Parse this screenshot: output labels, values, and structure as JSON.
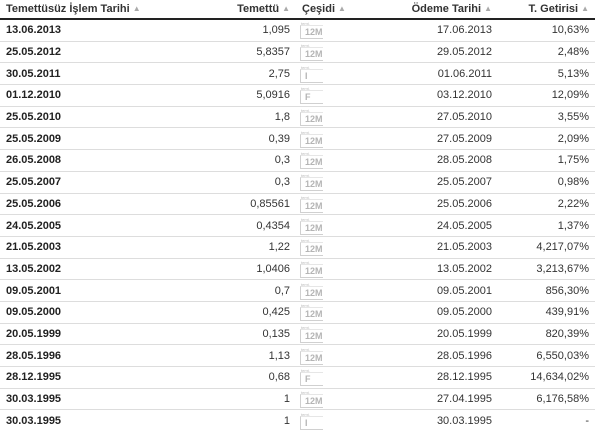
{
  "table": {
    "headers": {
      "date": "Temettüsüz İşlem Tarihi",
      "amount": "Temettü",
      "type": "Çeşidi",
      "payment_date": "Ödeme Tarihi",
      "yield": "T. Getirisi"
    },
    "type_icon_small_text": "temt.",
    "rows": [
      {
        "date": "13.06.2013",
        "amount": "1,095",
        "type": "12M",
        "payment_date": "17.06.2013",
        "yield": "10,63%"
      },
      {
        "date": "25.05.2012",
        "amount": "5,8357",
        "type": "12M",
        "payment_date": "29.05.2012",
        "yield": "2,48%"
      },
      {
        "date": "30.05.2011",
        "amount": "2,75",
        "type": "I",
        "payment_date": "01.06.2011",
        "yield": "5,13%"
      },
      {
        "date": "01.12.2010",
        "amount": "5,0916",
        "type": "F",
        "payment_date": "03.12.2010",
        "yield": "12,09%"
      },
      {
        "date": "25.05.2010",
        "amount": "1,8",
        "type": "12M",
        "payment_date": "27.05.2010",
        "yield": "3,55%"
      },
      {
        "date": "25.05.2009",
        "amount": "0,39",
        "type": "12M",
        "payment_date": "27.05.2009",
        "yield": "2,09%"
      },
      {
        "date": "26.05.2008",
        "amount": "0,3",
        "type": "12M",
        "payment_date": "28.05.2008",
        "yield": "1,75%"
      },
      {
        "date": "25.05.2007",
        "amount": "0,3",
        "type": "12M",
        "payment_date": "25.05.2007",
        "yield": "0,98%"
      },
      {
        "date": "25.05.2006",
        "amount": "0,85561",
        "type": "12M",
        "payment_date": "25.05.2006",
        "yield": "2,22%"
      },
      {
        "date": "24.05.2005",
        "amount": "0,4354",
        "type": "12M",
        "payment_date": "24.05.2005",
        "yield": "1,37%"
      },
      {
        "date": "21.05.2003",
        "amount": "1,22",
        "type": "12M",
        "payment_date": "21.05.2003",
        "yield": "4,217,07%"
      },
      {
        "date": "13.05.2002",
        "amount": "1,0406",
        "type": "12M",
        "payment_date": "13.05.2002",
        "yield": "3,213,67%"
      },
      {
        "date": "09.05.2001",
        "amount": "0,7",
        "type": "12M",
        "payment_date": "09.05.2001",
        "yield": "856,30%"
      },
      {
        "date": "09.05.2000",
        "amount": "0,425",
        "type": "12M",
        "payment_date": "09.05.2000",
        "yield": "439,91%"
      },
      {
        "date": "20.05.1999",
        "amount": "0,135",
        "type": "12M",
        "payment_date": "20.05.1999",
        "yield": "820,39%"
      },
      {
        "date": "28.05.1996",
        "amount": "1,13",
        "type": "12M",
        "payment_date": "28.05.1996",
        "yield": "6,550,03%"
      },
      {
        "date": "28.12.1995",
        "amount": "0,68",
        "type": "F",
        "payment_date": "28.12.1995",
        "yield": "14,634,02%"
      },
      {
        "date": "30.03.1995",
        "amount": "1",
        "type": "12M",
        "payment_date": "27.04.1995",
        "yield": "6,176,58%"
      },
      {
        "date": "30.03.1995",
        "amount": "1",
        "type": "I",
        "payment_date": "30.03.1995",
        "yield": "-"
      }
    ]
  }
}
